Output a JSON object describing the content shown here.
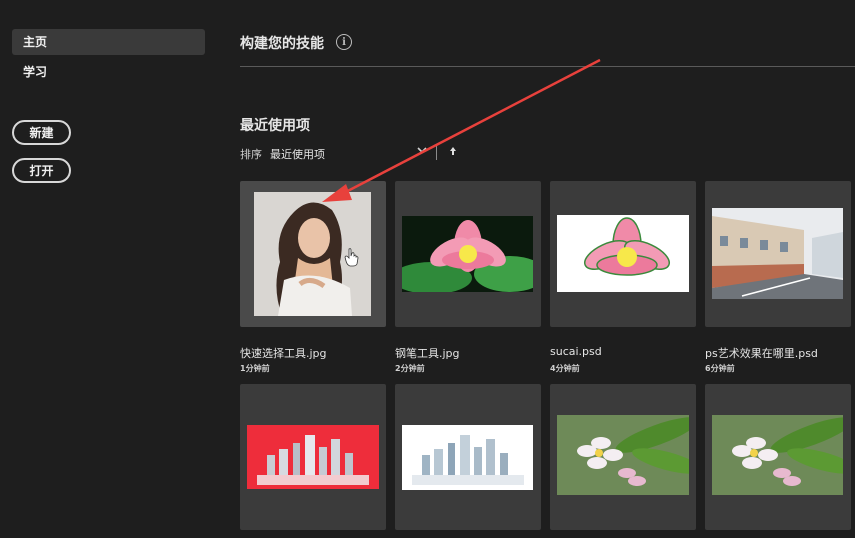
{
  "sidebar": {
    "items": [
      {
        "label": "主页",
        "active": true
      },
      {
        "label": "学习",
        "active": false
      }
    ],
    "new_button": "新建",
    "open_button": "打开"
  },
  "main": {
    "skills_title": "构建您的技能",
    "info_icon": "i",
    "recent_title": "最近使用项",
    "sort_label": "排序",
    "sort_value": "最近使用项"
  },
  "files": [
    {
      "name": "快速选择工具.jpg",
      "time": "1分钟前",
      "thumb": "portrait"
    },
    {
      "name": "钢笔工具.jpg",
      "time": "2分钟前",
      "thumb": "lotus-green"
    },
    {
      "name": "sucai.psd",
      "time": "4分钟前",
      "thumb": "lotus-cutout"
    },
    {
      "name": "ps艺术效果在哪里.psd",
      "time": "6分钟前",
      "thumb": "street"
    },
    {
      "name": "",
      "time": "",
      "thumb": "city-red"
    },
    {
      "name": "",
      "time": "",
      "thumb": "city-white"
    },
    {
      "name": "",
      "time": "",
      "thumb": "plumeria"
    },
    {
      "name": "",
      "time": "",
      "thumb": "plumeria"
    }
  ],
  "colors": {
    "background": "#1e1e1e",
    "active_nav": "#3a3a3a",
    "tile": "#3b3b3b",
    "annotation_arrow": "#e8413c"
  },
  "icons": {
    "info": "info-icon",
    "sort_dropdown": "chevron-down-icon",
    "sort_direction": "arrow-up-icon",
    "cursor": "hand-cursor-icon"
  }
}
